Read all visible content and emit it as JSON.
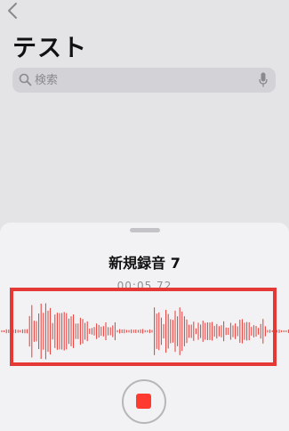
{
  "header": {
    "title": "テスト"
  },
  "search": {
    "placeholder": "検索",
    "value": ""
  },
  "recording_sheet": {
    "title": "新規録音 7",
    "elapsed": "00:05.72"
  },
  "colors": {
    "accent": "#ff3b30",
    "waveform": "#e53935",
    "highlight": "#e53935"
  },
  "icons": {
    "back": "chevron-left-icon",
    "search": "magnifier-icon",
    "mic": "microphone-icon",
    "stop": "stop-square-icon"
  }
}
